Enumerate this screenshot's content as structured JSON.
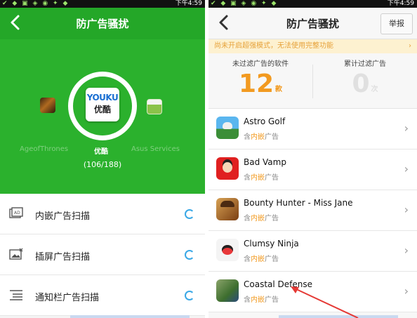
{
  "left": {
    "status_bar": {
      "time": "下午4:59"
    },
    "header": {
      "title": "防广告骚扰"
    },
    "scan": {
      "current_app_icon_text_top": "YOUKU",
      "current_app_icon_text_bottom": "优酷",
      "prev_app": "AgeofThrones",
      "current_app": "优酷",
      "next_app": "Asus Services",
      "progress": "(106/188)"
    },
    "menu": [
      {
        "label": "内嵌广告扫描",
        "icon": "embedded-ad-icon"
      },
      {
        "label": "插屏广告扫描",
        "icon": "interstitial-ad-icon"
      },
      {
        "label": "通知栏广告扫描",
        "icon": "notification-ad-icon"
      }
    ]
  },
  "right": {
    "status_bar": {
      "time": "下午4:59"
    },
    "header": {
      "title": "防广告骚扰",
      "report_button": "举报"
    },
    "warning": {
      "text": "尚未开启超强模式，无法使用完整功能"
    },
    "stats": {
      "unfiltered_label": "未过滤广告的软件",
      "unfiltered_value": "12",
      "unfiltered_unit": "款",
      "filtered_label": "累计过滤广告",
      "filtered_value": "0",
      "filtered_unit": "次"
    },
    "apps": [
      {
        "name": "Astro Golf",
        "sub_prefix": "含",
        "sub_highlight": "内嵌",
        "sub_suffix": "广告"
      },
      {
        "name": "Bad Vamp",
        "sub_prefix": "含",
        "sub_highlight": "内嵌",
        "sub_suffix": "广告"
      },
      {
        "name": "Bounty Hunter - Miss Jane",
        "sub_prefix": "含",
        "sub_highlight": "内嵌",
        "sub_suffix": "广告"
      },
      {
        "name": "Clumsy Ninja",
        "sub_prefix": "含",
        "sub_highlight": "内嵌",
        "sub_suffix": "广告"
      },
      {
        "name": "Coastal Defense",
        "sub_prefix": "含",
        "sub_highlight": "内嵌",
        "sub_suffix": "广告"
      }
    ]
  },
  "colors": {
    "green": "#2bb12d",
    "orange": "#f29a20",
    "spinner_blue": "#3aa8e6",
    "annotation_red": "#e53935"
  }
}
